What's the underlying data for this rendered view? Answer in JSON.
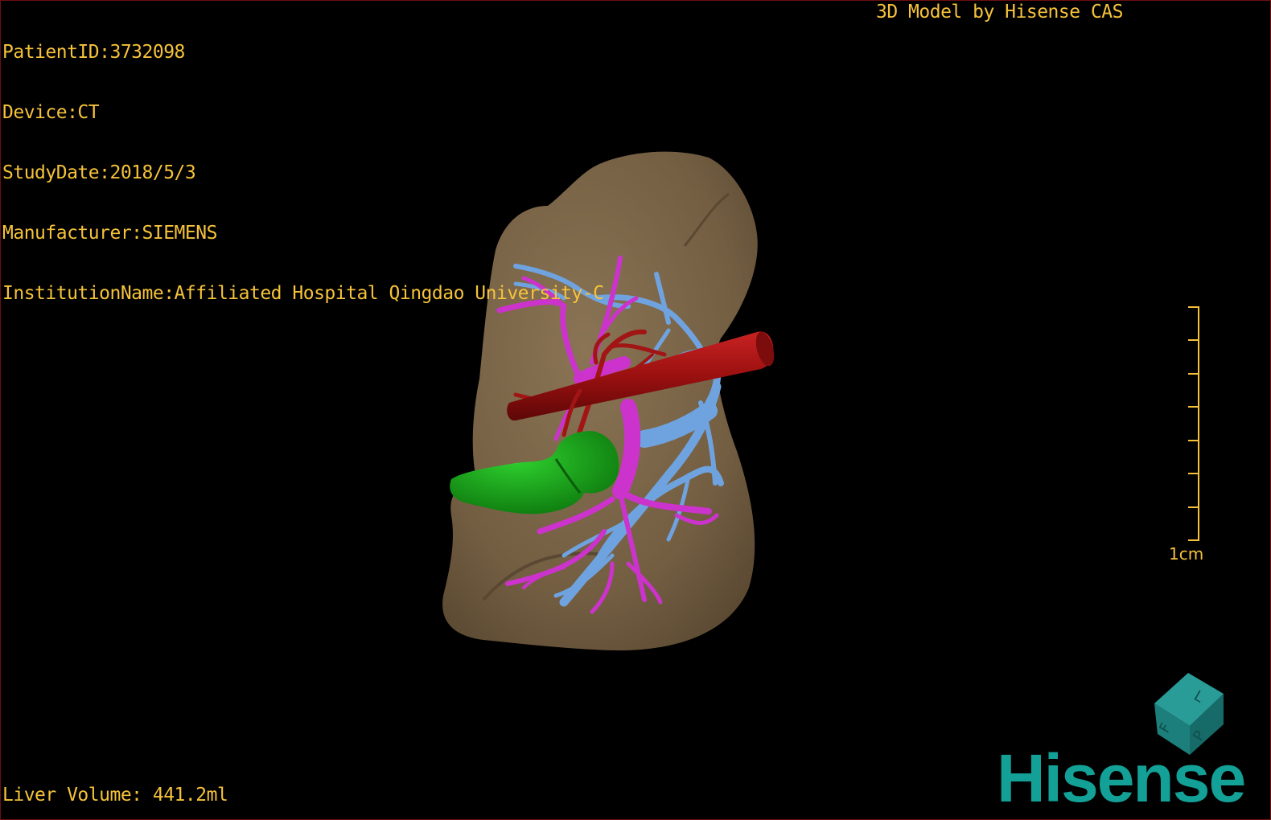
{
  "overlay": {
    "patient_id": "PatientID:3732098",
    "device": "Device:CT",
    "study_date": "StudyDate:2018/5/3",
    "manufacturer": "Manufacturer:SIEMENS",
    "institution": "InstitutionName:Affiliated Hospital Qingdao University-C",
    "banner": "3D Model by Hisense CAS",
    "liver_volume": "Liver Volume: 441.2ml"
  },
  "scale": {
    "label": "1cm"
  },
  "orientation_cube": {
    "faces": [
      "F",
      "L",
      "P"
    ],
    "color": "#1e8c88"
  },
  "brand": {
    "name": "Hisense",
    "color": "#13a096"
  },
  "colors": {
    "text": "#f5c23a",
    "liver": "#7a6548",
    "portal_vein": "#cc33cc",
    "hepatic_vein": "#6fa3e0",
    "artery": "#a11515",
    "gallbladder": "#1aa31a"
  }
}
